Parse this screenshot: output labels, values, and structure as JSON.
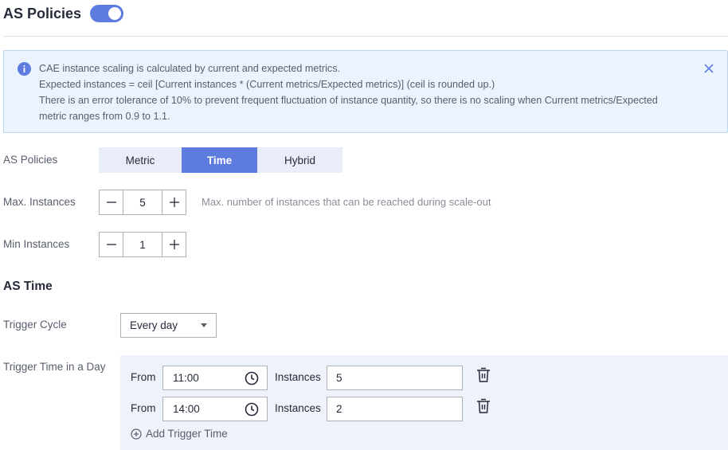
{
  "header": {
    "title": "AS Policies",
    "toggle_on": true,
    "accent_color": "#5e7ce0"
  },
  "alert": {
    "icon": "info-icon",
    "lines": [
      "CAE instance scaling is calculated by current and expected metrics.",
      "Expected instances = ceil [Current instances * (Current metrics/Expected metrics)] (ceil is rounded up.)",
      "There is an error tolerance of 10% to prevent frequent fluctuation of instance quantity, so there is no scaling when Current metrics/Expected",
      "metric ranges from 0.9 to 1.1."
    ],
    "background_color": "#ebf4fd"
  },
  "policy": {
    "label": "AS Policies",
    "options": [
      "Metric",
      "Time",
      "Hybrid"
    ],
    "selected": "Time"
  },
  "max_instances": {
    "label": "Max. Instances",
    "value": "5",
    "hint": "Max. number of instances that can be reached during scale-out"
  },
  "min_instances": {
    "label": "Min Instances",
    "value": "1"
  },
  "as_time": {
    "title": "AS Time",
    "trigger_cycle": {
      "label": "Trigger Cycle",
      "value": "Every day"
    },
    "trigger_time_label": "Trigger Time in a Day",
    "from_label": "From",
    "instances_label": "Instances",
    "triggers": [
      {
        "time": "11:00",
        "instances": "5"
      },
      {
        "time": "14:00",
        "instances": "2"
      }
    ],
    "add_label": "Add Trigger Time"
  }
}
